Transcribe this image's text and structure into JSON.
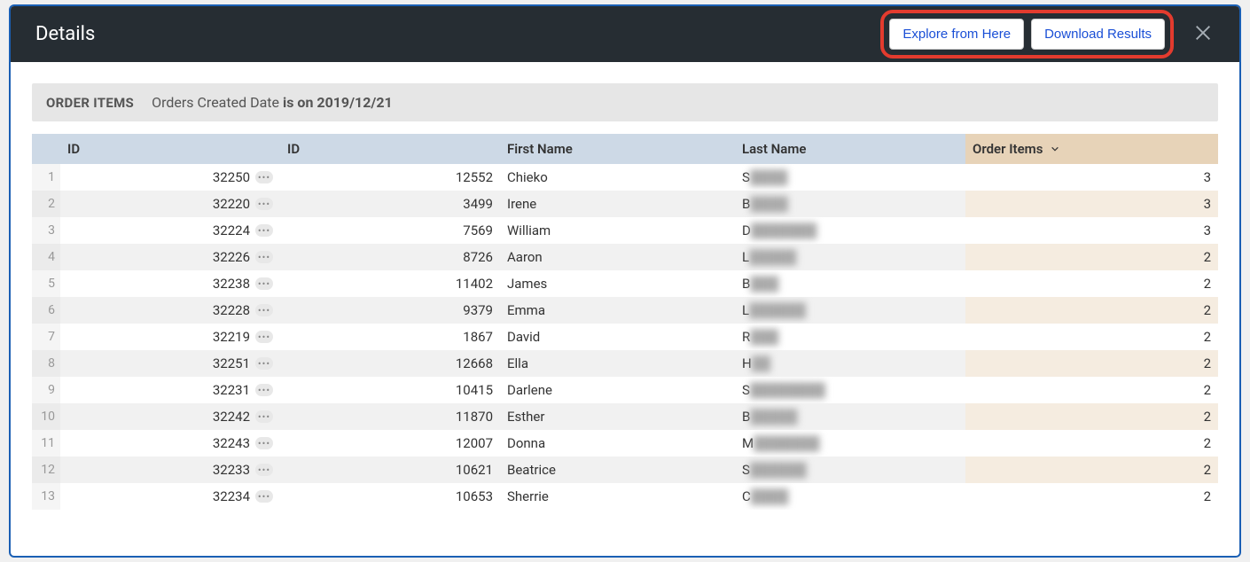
{
  "header": {
    "title": "Details",
    "explore_btn": "Explore from Here",
    "download_btn": "Download Results"
  },
  "filter": {
    "section": "ORDER ITEMS",
    "field": "Orders Created Date",
    "operator_value": "is on 2019/12/21"
  },
  "columns": {
    "id1": "ID",
    "id2": "ID",
    "first_name": "First Name",
    "last_name": "Last Name",
    "order_items": "Order Items"
  },
  "rows": [
    {
      "n": "1",
      "id1": "32250",
      "id2": "12552",
      "fn": "Chieko",
      "ln_first": "S",
      "ln_rest": "████",
      "oi": "3"
    },
    {
      "n": "2",
      "id1": "32220",
      "id2": "3499",
      "fn": "Irene",
      "ln_first": "B",
      "ln_rest": "████",
      "oi": "3"
    },
    {
      "n": "3",
      "id1": "32224",
      "id2": "7569",
      "fn": "William",
      "ln_first": "D",
      "ln_rest": "███████",
      "oi": "3"
    },
    {
      "n": "4",
      "id1": "32226",
      "id2": "8726",
      "fn": "Aaron",
      "ln_first": "L",
      "ln_rest": "█████",
      "oi": "2"
    },
    {
      "n": "5",
      "id1": "32238",
      "id2": "11402",
      "fn": "James",
      "ln_first": "B",
      "ln_rest": "███",
      "oi": "2"
    },
    {
      "n": "6",
      "id1": "32228",
      "id2": "9379",
      "fn": "Emma",
      "ln_first": "L",
      "ln_rest": "██████",
      "oi": "2"
    },
    {
      "n": "7",
      "id1": "32219",
      "id2": "1867",
      "fn": "David",
      "ln_first": "R",
      "ln_rest": "███",
      "oi": "2"
    },
    {
      "n": "8",
      "id1": "32251",
      "id2": "12668",
      "fn": "Ella",
      "ln_first": "H",
      "ln_rest": "██",
      "oi": "2"
    },
    {
      "n": "9",
      "id1": "32231",
      "id2": "10415",
      "fn": "Darlene",
      "ln_first": "S",
      "ln_rest": "████████",
      "oi": "2"
    },
    {
      "n": "10",
      "id1": "32242",
      "id2": "11870",
      "fn": "Esther",
      "ln_first": "B",
      "ln_rest": "█████",
      "oi": "2"
    },
    {
      "n": "11",
      "id1": "32243",
      "id2": "12007",
      "fn": "Donna",
      "ln_first": "M",
      "ln_rest": "███████",
      "oi": "2"
    },
    {
      "n": "12",
      "id1": "32233",
      "id2": "10621",
      "fn": "Beatrice",
      "ln_first": "S",
      "ln_rest": "██████",
      "oi": "2"
    },
    {
      "n": "13",
      "id1": "32234",
      "id2": "10653",
      "fn": "Sherrie",
      "ln_first": "C",
      "ln_rest": "████",
      "oi": "2"
    }
  ]
}
